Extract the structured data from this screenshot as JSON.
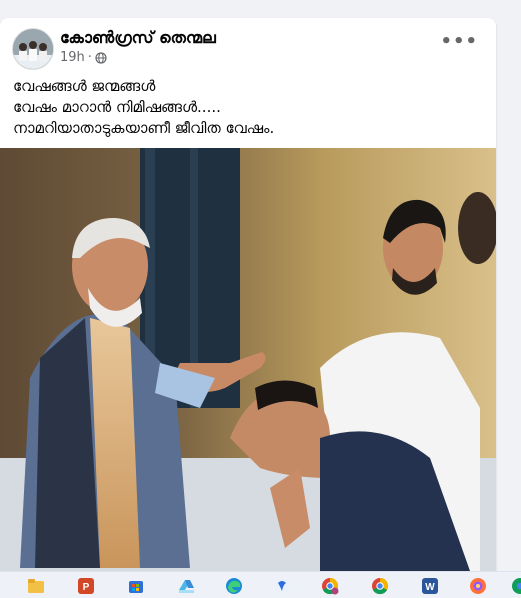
{
  "post": {
    "author": "കോൺഗ്രസ് തെന്മല",
    "time": "19h",
    "privacy_icon": "globe-icon",
    "more_icon": "more-options-icon",
    "more_label": "•••",
    "caption_lines": [
      "വേഷങ്ങൾ ജന്മങ്ങൾ",
      "വേഷം മാറാൻ നിമിഷങ്ങൾ.....",
      "നാമറിയാതാടുകയാണീ ജീവിത വേഷം."
    ]
  },
  "taskbar": {
    "icons": [
      "file-explorer-icon",
      "powerpoint-icon",
      "store-icon",
      "drive-icon",
      "edge-icon",
      "zoom-icon",
      "chrome-profile-icon",
      "chrome-icon",
      "word-icon",
      "firefox-icon",
      "chrome-extra-icon"
    ]
  },
  "colors": {
    "page_bg": "#f0f2f5",
    "card_bg": "#ffffff",
    "text_primary": "#050505",
    "text_secondary": "#65676b"
  }
}
